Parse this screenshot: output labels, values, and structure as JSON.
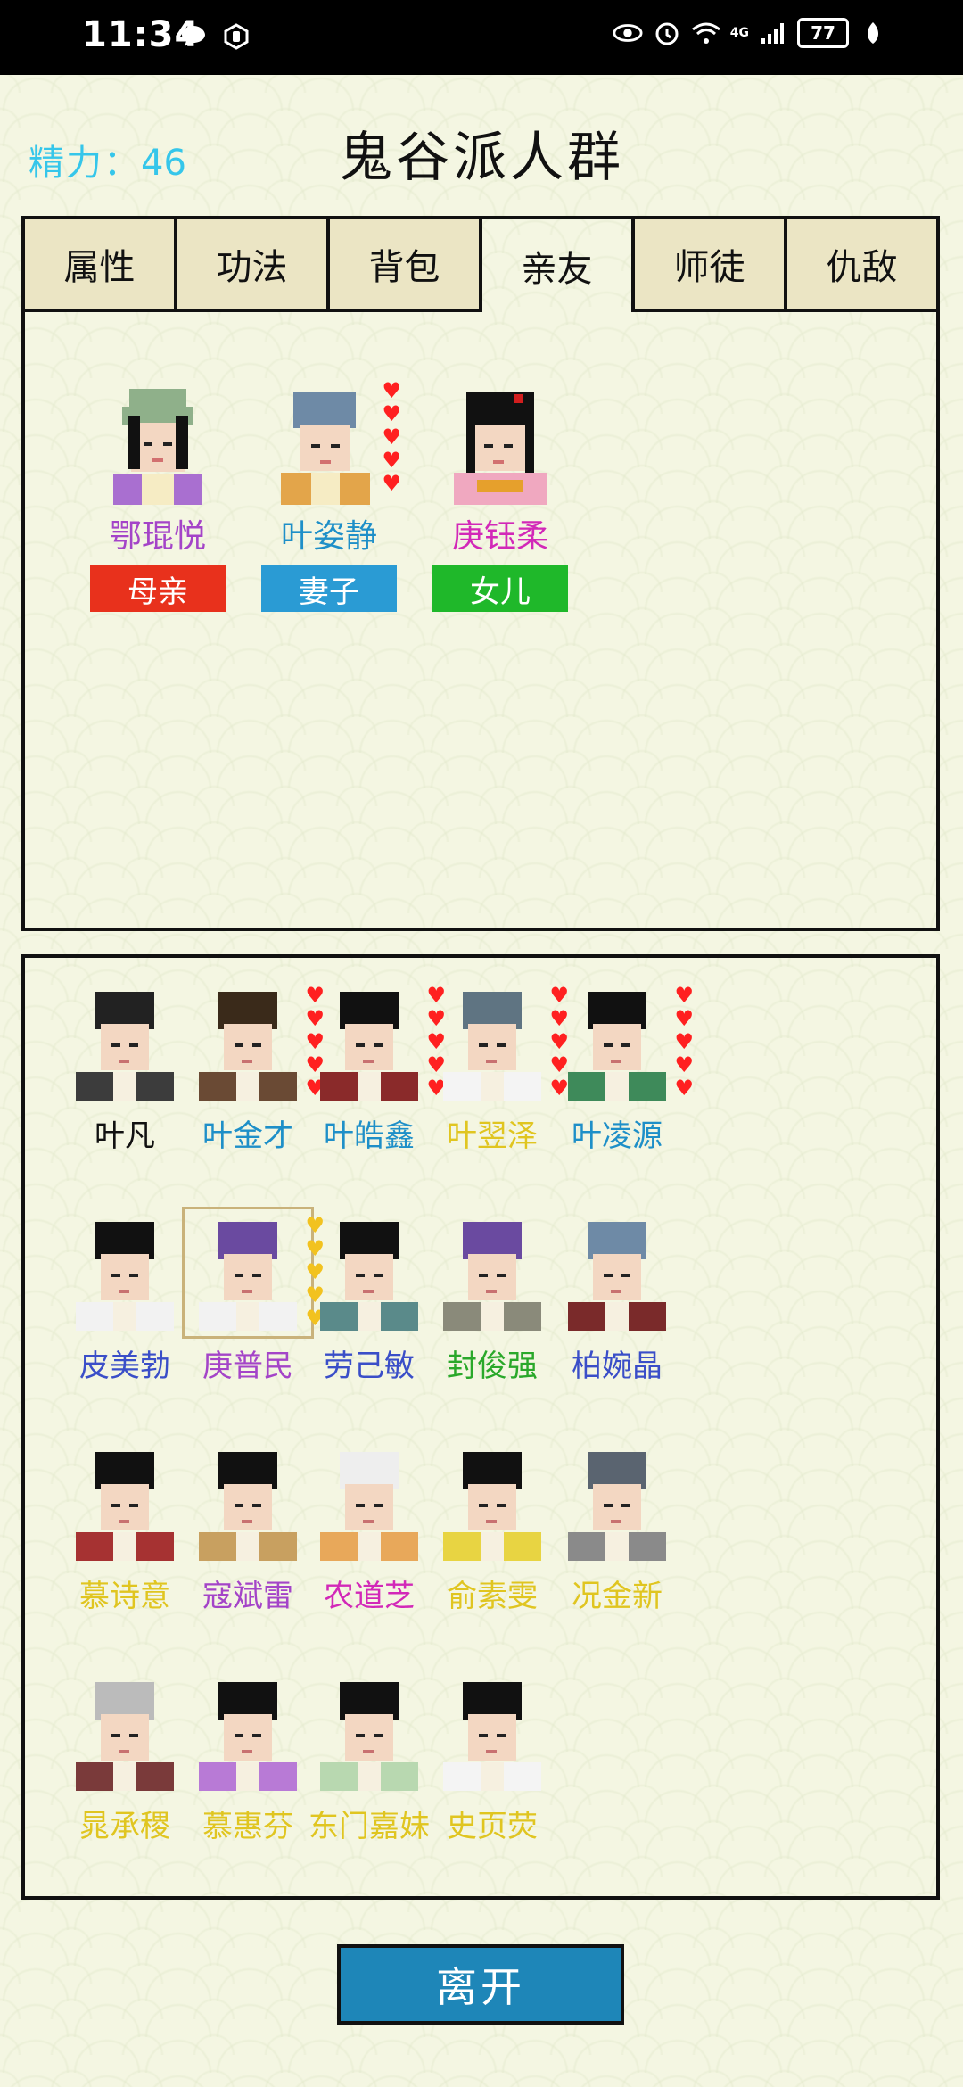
{
  "status_bar": {
    "time": "11:34",
    "battery": "77",
    "network": "4G"
  },
  "header": {
    "energy_label": "精力：",
    "energy_value": "46",
    "title": "鬼谷派人群"
  },
  "tabs": [
    {
      "label": "属性",
      "active": false
    },
    {
      "label": "功法",
      "active": false
    },
    {
      "label": "背包",
      "active": false
    },
    {
      "label": "亲友",
      "active": true
    },
    {
      "label": "师徒",
      "active": false
    },
    {
      "label": "仇敌",
      "active": false
    }
  ],
  "relatives": [
    {
      "name": "鄂琨悦",
      "name_color": "#a444c8",
      "role": "母亲",
      "role_color": "#e8311c",
      "hearts": 0
    },
    {
      "name": "叶姿静",
      "name_color": "#1e8fc8",
      "role": "妻子",
      "role_color": "#2a9bd4",
      "hearts": 5
    },
    {
      "name": "庚钰柔",
      "name_color": "#d228b8",
      "role": "女儿",
      "role_color": "#1fb82a",
      "hearts": 0
    }
  ],
  "people": [
    {
      "name": "叶凡",
      "color": "#111111",
      "hearts": 0,
      "heart_type": "red"
    },
    {
      "name": "叶金才",
      "color": "#1e8fc8",
      "hearts": 5,
      "heart_type": "red"
    },
    {
      "name": "叶皓鑫",
      "color": "#1e8fc8",
      "hearts": 5,
      "heart_type": "red"
    },
    {
      "name": "叶翌泽",
      "color": "#e0c520",
      "hearts": 5,
      "heart_type": "red"
    },
    {
      "name": "叶凌源",
      "color": "#1e8fc8",
      "hearts": 5,
      "heart_type": "red"
    },
    {
      "name": "皮美勃",
      "color": "#3a4ec8",
      "hearts": 0,
      "heart_type": "red"
    },
    {
      "name": "庚普民",
      "color": "#a444c8",
      "hearts": 5,
      "heart_type": "gold"
    },
    {
      "name": "劳己敏",
      "color": "#3a4ec8",
      "hearts": 0,
      "heart_type": "red"
    },
    {
      "name": "封俊强",
      "color": "#2aa82a",
      "hearts": 0,
      "heart_type": "red"
    },
    {
      "name": "柏婉晶",
      "color": "#3a4ec8",
      "hearts": 0,
      "heart_type": "red"
    },
    {
      "name": "慕诗意",
      "color": "#e0c520",
      "hearts": 0,
      "heart_type": "red"
    },
    {
      "name": "寇斌雷",
      "color": "#a444c8",
      "hearts": 0,
      "heart_type": "red"
    },
    {
      "name": "农道芝",
      "color": "#d228b8",
      "hearts": 0,
      "heart_type": "red"
    },
    {
      "name": "俞素雯",
      "color": "#e0c520",
      "hearts": 0,
      "heart_type": "red"
    },
    {
      "name": "况金新",
      "color": "#e0c520",
      "hearts": 0,
      "heart_type": "red"
    },
    {
      "name": "晁承稷",
      "color": "#e0c520",
      "hearts": 0,
      "heart_type": "red"
    },
    {
      "name": "慕惠芬",
      "color": "#e0c520",
      "hearts": 0,
      "heart_type": "red"
    },
    {
      "name": "东门嘉妹",
      "color": "#e0c520",
      "hearts": 0,
      "heart_type": "red"
    },
    {
      "name": "史页荧",
      "color": "#e0c520",
      "hearts": 0,
      "heart_type": "red"
    }
  ],
  "leave_button": "离开"
}
